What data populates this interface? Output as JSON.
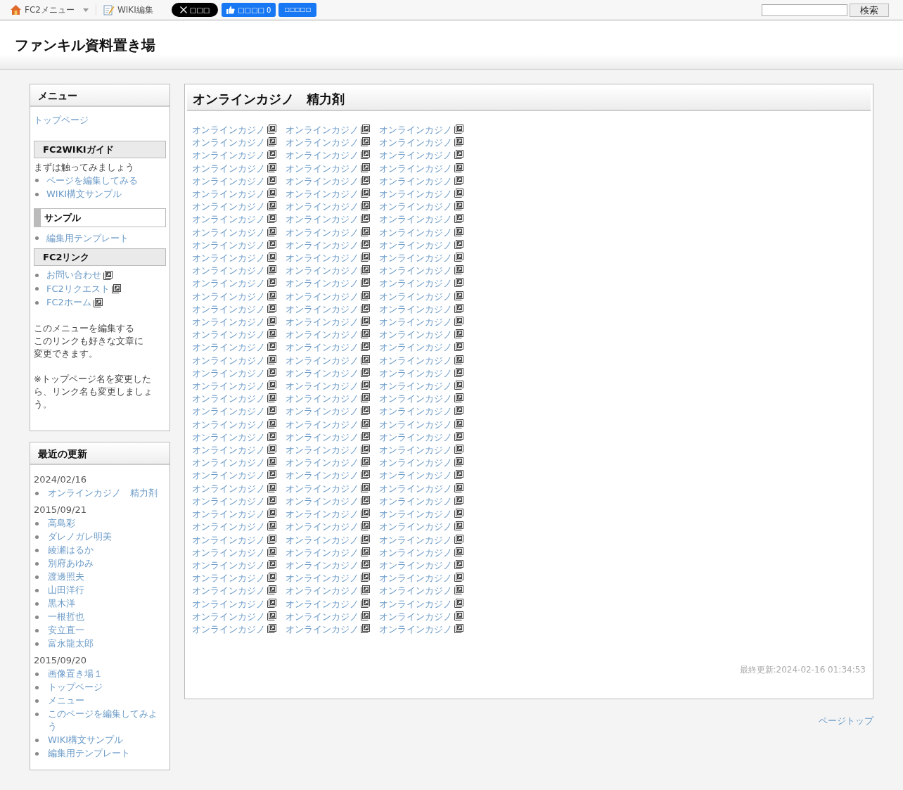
{
  "top_bar": {
    "fc2_menu": "FC2メニュー",
    "wiki_edit": "WIKI編集",
    "x_button": "□□□",
    "like_button": "□□□□ 0",
    "share_button": "□□□□□",
    "search": {
      "button": "検索"
    }
  },
  "site_title": "ファンキル資料置き場",
  "sidebar": {
    "menu": {
      "title": "メニュー",
      "items": [
        {
          "kind": "link",
          "text": "トップページ"
        },
        {
          "kind": "heading",
          "text": "FC2WIKIガイド"
        },
        {
          "kind": "text",
          "text": "まずは触ってみましょう"
        },
        {
          "kind": "bullet",
          "text": "ページを編集してみる",
          "external": false
        },
        {
          "kind": "bullet",
          "text": "WIKI構文サンプル",
          "external": false
        },
        {
          "kind": "heading-bar",
          "text": "サンプル"
        },
        {
          "kind": "bullet",
          "text": "編集用テンプレート",
          "external": false
        },
        {
          "kind": "heading",
          "text": "FC2リンク"
        },
        {
          "kind": "bullet",
          "text": "お問い合わせ",
          "external": true
        },
        {
          "kind": "bullet",
          "text": "FC2リクエスト",
          "external": true
        },
        {
          "kind": "bullet",
          "text": "FC2ホーム",
          "external": true
        },
        {
          "kind": "note",
          "text": "このメニューを編集する"
        },
        {
          "kind": "text",
          "text": "このリンクも好きな文章に"
        },
        {
          "kind": "text",
          "text": "変更できます。"
        },
        {
          "kind": "note",
          "text": "※トップページ名を変更したら、リンク名も変更しましょう。"
        }
      ]
    },
    "recent": {
      "title": "最近の更新",
      "groups": [
        {
          "date": "2024/02/16",
          "items": [
            "オンラインカジノ　精力剤"
          ]
        },
        {
          "date": "2015/09/21",
          "items": [
            "高島彩",
            "ダレノガレ明美",
            "綾瀬はるか",
            "別府あゆみ",
            "渡邊照夫",
            "山田洋行",
            "黒木洋",
            "一根哲也",
            "安立直一",
            "富永龍太郎"
          ]
        },
        {
          "date": "2015/09/20",
          "items": [
            "画像置き場１",
            "トップページ",
            "メニュー",
            "このページを編集してみよう",
            "WIKI構文サンプル",
            "編集用テンプレート"
          ]
        }
      ]
    }
  },
  "main": {
    "title": "オンラインカジノ　精力剤",
    "links": [
      [
        "オンラインカジノ",
        "オンラインカジノ",
        "オンラインカジノ"
      ],
      [
        "オンラインカジノ",
        "オンラインカジノ",
        "オンラインカジノ"
      ],
      [
        "オンラインカジノ",
        "オンラインカジノ",
        "オンラインカジノ"
      ],
      [
        "オンラインカジノ",
        "オンラインカジノ",
        "オンラインカジノ"
      ],
      [
        "オンラインカジノ",
        "オンラインカジノ",
        "オンラインカジノ"
      ],
      [
        "オンラインカジノ",
        "オンラインカジノ",
        "オンラインカジノ"
      ],
      [
        "オンラインカジノ",
        "オンラインカジノ",
        "オンラインカジノ"
      ],
      [
        "オンラインカジノ",
        "オンラインカジノ",
        "オンラインカジノ"
      ],
      [
        "オンラインカジノ",
        "オンラインカジノ",
        "オンラインカジノ"
      ],
      [
        "オンラインカジノ",
        "オンラインカジノ",
        "オンラインカジノ"
      ],
      [
        "オンラインカジノ",
        "オンラインカジノ",
        "オンラインカジノ"
      ],
      [
        "オンラインカジノ",
        "オンラインカジノ",
        "オンラインカジノ"
      ],
      [
        "オンラインカジノ",
        "オンラインカジノ",
        "オンラインカジノ"
      ],
      [
        "オンラインカジノ",
        "オンラインカジノ",
        "オンラインカジノ"
      ],
      [
        "オンラインカジノ",
        "オンラインカジノ",
        "オンラインカジノ"
      ],
      [
        "オンラインカジノ",
        "オンラインカジノ",
        "オンラインカジノ"
      ],
      [
        "オンラインカジノ",
        "オンラインカジノ",
        "オンラインカジノ"
      ],
      [
        "オンラインカジノ",
        "オンラインカジノ",
        "オンラインカジノ"
      ],
      [
        "オンラインカジノ",
        "オンラインカジノ",
        "オンラインカジノ"
      ],
      [
        "オンラインカジノ",
        "オンラインカジノ",
        "オンラインカジノ"
      ],
      [
        "オンラインカジノ",
        "オンラインカジノ",
        "オンラインカジノ"
      ],
      [
        "オンラインカジノ",
        "オンラインカジノ",
        "オンラインカジノ"
      ],
      [
        "オンラインカジノ",
        "オンラインカジノ",
        "オンラインカジノ"
      ],
      [
        "オンラインカジノ",
        "オンラインカジノ",
        "オンラインカジノ"
      ],
      [
        "オンラインカジノ",
        "オンラインカジノ",
        "オンラインカジノ"
      ],
      [
        "オンラインカジノ",
        "オンラインカジノ",
        "オンラインカジノ"
      ],
      [
        "オンラインカジノ",
        "オンラインカジノ",
        "オンラインカジノ"
      ],
      [
        "オンラインカジノ",
        "オンラインカジノ",
        "オンラインカジノ"
      ],
      [
        "オンラインカジノ",
        "オンラインカジノ",
        "オンラインカジノ"
      ],
      [
        "オンラインカジノ",
        "オンラインカジノ",
        "オンラインカジノ"
      ],
      [
        "オンラインカジノ",
        "オンラインカジノ",
        "オンラインカジノ"
      ],
      [
        "オンラインカジノ",
        "オンラインカジノ",
        "オンラインカジノ"
      ],
      [
        "オンラインカジノ",
        "オンラインカジノ",
        "オンラインカジノ"
      ],
      [
        "オンラインカジノ",
        "オンラインカジノ",
        "オンラインカジノ"
      ],
      [
        "オンラインカジノ",
        "オンラインカジノ",
        "オンラインカジノ"
      ],
      [
        "オンラインカジノ",
        "オンラインカジノ",
        "オンラインカジノ"
      ],
      [
        "オンラインカジノ",
        "オンラインカジノ",
        "オンラインカジノ"
      ],
      [
        "オンラインカジノ",
        "オンラインカジノ",
        "オンラインカジノ"
      ],
      [
        "オンラインカジノ",
        "オンラインカジノ",
        "オンラインカジノ"
      ],
      [
        "オンラインカジノ",
        "オンラインカジノ",
        "オンラインカジノ"
      ]
    ],
    "updated": "最終更新:2024-02-16 01:34:53"
  },
  "page_top": "ページトップ"
}
